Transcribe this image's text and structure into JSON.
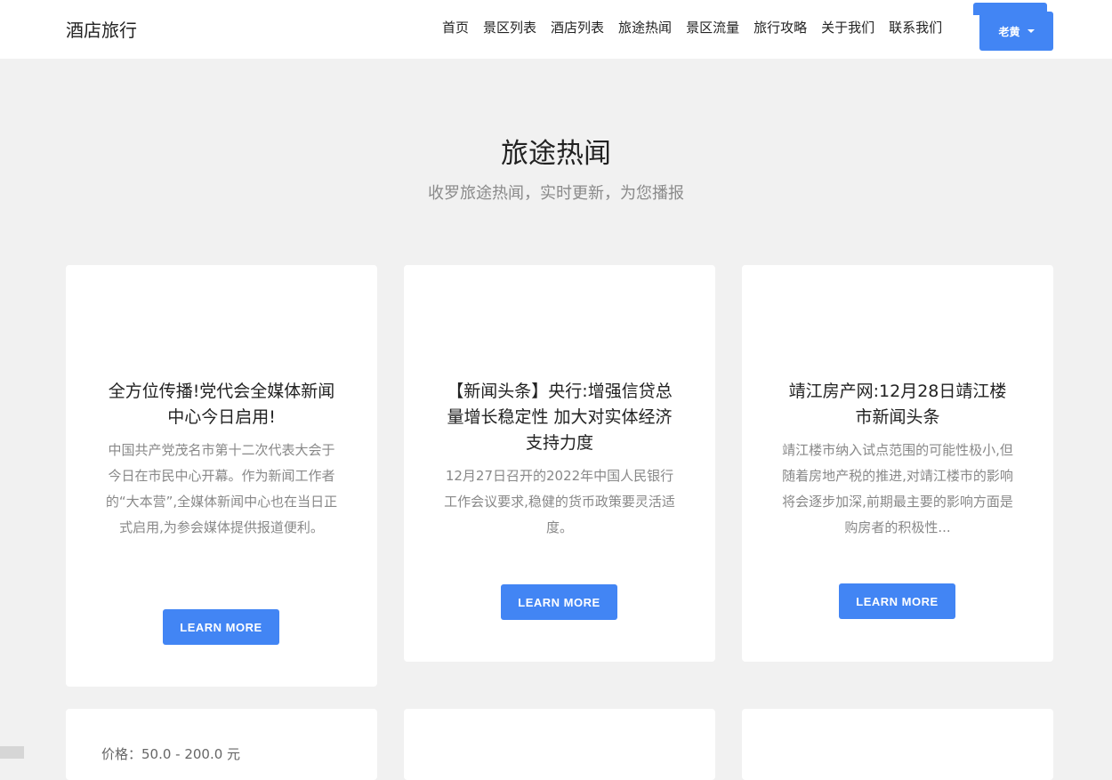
{
  "brand": "酒店旅行",
  "nav": {
    "links": [
      "首页",
      "景区列表",
      "酒店列表",
      "旅途热闻",
      "景区流量",
      "旅行攻略",
      "关于我们",
      "联系我们"
    ],
    "user_label": "老黄"
  },
  "section": {
    "title": "旅途热闻",
    "subtitle": "收罗旅途热闻，实时更新，为您播报"
  },
  "cards": [
    {
      "title": "全方位传播!党代会全媒体新闻中心今日启用!",
      "description": "中国共产党茂名市第十二次代表大会于今日在市民中心开幕。作为新闻工作者的“大本营”,全媒体新闻中心也在当日正式启用,为参会媒体提供报道便利。",
      "button": "LEARN MORE"
    },
    {
      "title": "【新闻头条】央行:增强信贷总量增长稳定性 加大对实体经济支持力度",
      "description": "12月27日召开的2022年中国人民银行工作会议要求,稳健的货币政策要灵活适度。",
      "button": "LEARN MORE"
    },
    {
      "title": "靖江房产网:12月28日靖江楼市新闻头条",
      "description": "靖江楼市纳入试点范围的可能性极小,但随着房地产税的推进,对靖江楼市的影响将会逐步加深,前期最主要的影响方面是购房者的积极性...",
      "button": "LEARN MORE"
    }
  ],
  "bottom_cards": {
    "price_text": "价格：50.0 - 200.0 元"
  }
}
